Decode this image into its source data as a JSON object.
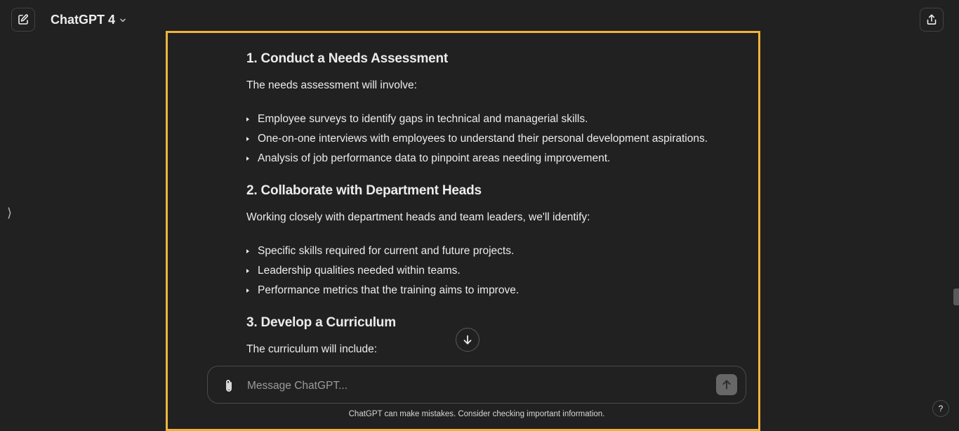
{
  "header": {
    "model_name": "ChatGPT 4"
  },
  "icons": {
    "new_chat": "pencil-square-icon",
    "share": "share-upload-icon",
    "sidebar_toggle": "chevron-right-icon",
    "scroll_down": "arrow-down-icon",
    "attach": "paperclip-icon",
    "send": "arrow-up-icon"
  },
  "sidebar_toggle_glyph": "⟩",
  "message": {
    "sections": [
      {
        "heading": "1. Conduct a Needs Assessment",
        "intro": "The needs assessment will involve:",
        "bullets": [
          "Employee surveys to identify gaps in technical and managerial skills.",
          "One-on-one interviews with employees to understand their personal development aspirations.",
          "Analysis of job performance data to pinpoint areas needing improvement."
        ]
      },
      {
        "heading": "2. Collaborate with Department Heads",
        "intro": "Working closely with department heads and team leaders, we'll identify:",
        "bullets": [
          "Specific skills required for current and future projects.",
          "Leadership qualities needed within teams.",
          "Performance metrics that the training aims to improve."
        ]
      },
      {
        "heading": "3. Develop a Curriculum",
        "intro": "The curriculum will include:",
        "bullets": []
      }
    ]
  },
  "composer": {
    "placeholder": "Message ChatGPT..."
  },
  "footer": {
    "disclaimer": "ChatGPT can make mistakes. Consider checking important information.",
    "help_label": "?"
  },
  "colors": {
    "highlight": "#f0b43a",
    "background": "#212121",
    "text": "#ececec"
  }
}
